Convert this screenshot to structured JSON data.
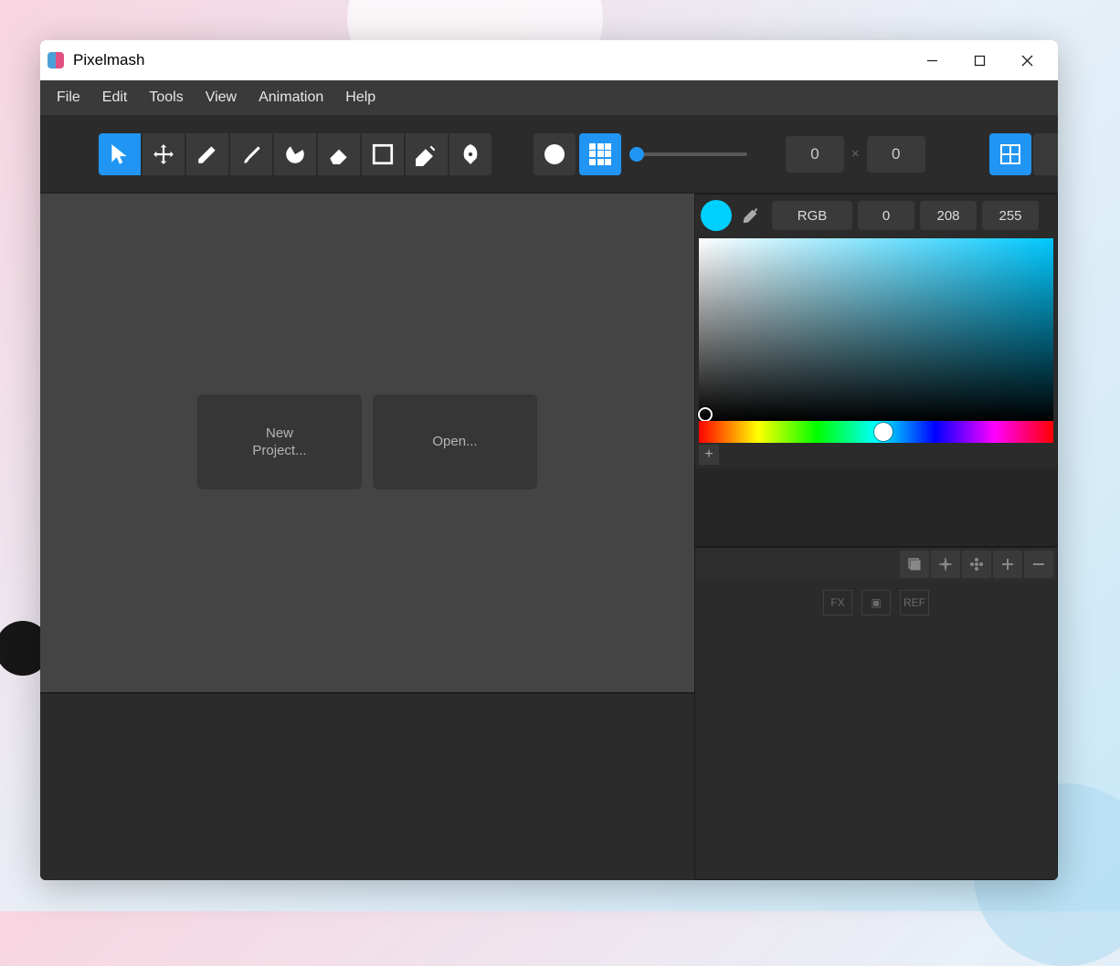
{
  "title": "Pixelmash",
  "menu": {
    "file": "File",
    "edit": "Edit",
    "tools": "Tools",
    "view": "View",
    "animation": "Animation",
    "help": "Help"
  },
  "toolbar": {
    "size_w": "0",
    "size_h": "0",
    "times": "×"
  },
  "start": {
    "new_project": "New\nProject...",
    "open": "Open..."
  },
  "color": {
    "mode": "RGB",
    "r": "0",
    "g": "208",
    "b": "255",
    "current_hex": "#00d0ff",
    "add": "+"
  },
  "layer_types": {
    "fx": "FX",
    "img": "▣",
    "ref": "REF"
  }
}
